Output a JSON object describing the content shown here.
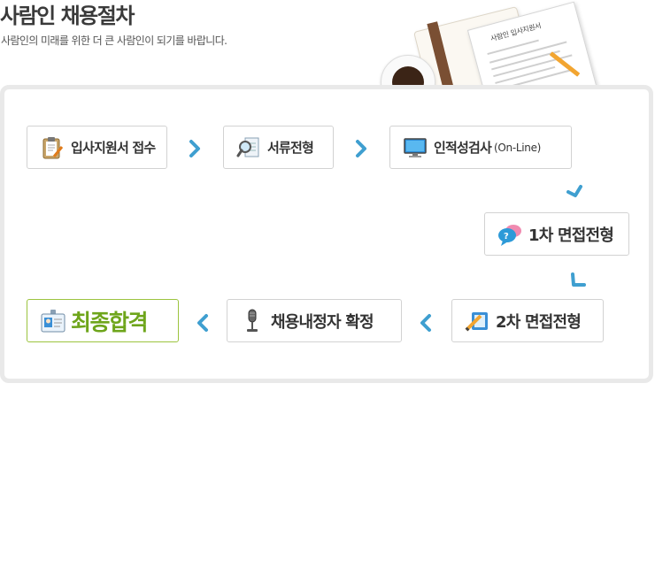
{
  "header": {
    "title": "사람인 채용절차",
    "subtitle": "사람인의 미래를 위한 더 큰 사람인이 되기를 바랍니다.",
    "paper_title": "사람인 입사지원서"
  },
  "steps": [
    {
      "label": "입사지원서 접수",
      "icon": "clipboard-icon"
    },
    {
      "label": "서류전형",
      "icon": "magnifier-document-icon"
    },
    {
      "label": "인적성검사",
      "sub": "(On-Line)",
      "icon": "monitor-icon"
    },
    {
      "label": "1차 면접전형",
      "icon": "speech-bubbles-icon"
    },
    {
      "label": "2차 면접전형",
      "icon": "pencil-notepad-icon"
    },
    {
      "label": "채용내정자 확정",
      "icon": "microphone-icon"
    },
    {
      "label": "최종합격",
      "icon": "id-card-icon"
    }
  ],
  "colors": {
    "arrow": "#3f9fd0",
    "final_text": "#6ea51b",
    "final_border": "#9cc43f",
    "panel_border": "#e9e9e9"
  }
}
